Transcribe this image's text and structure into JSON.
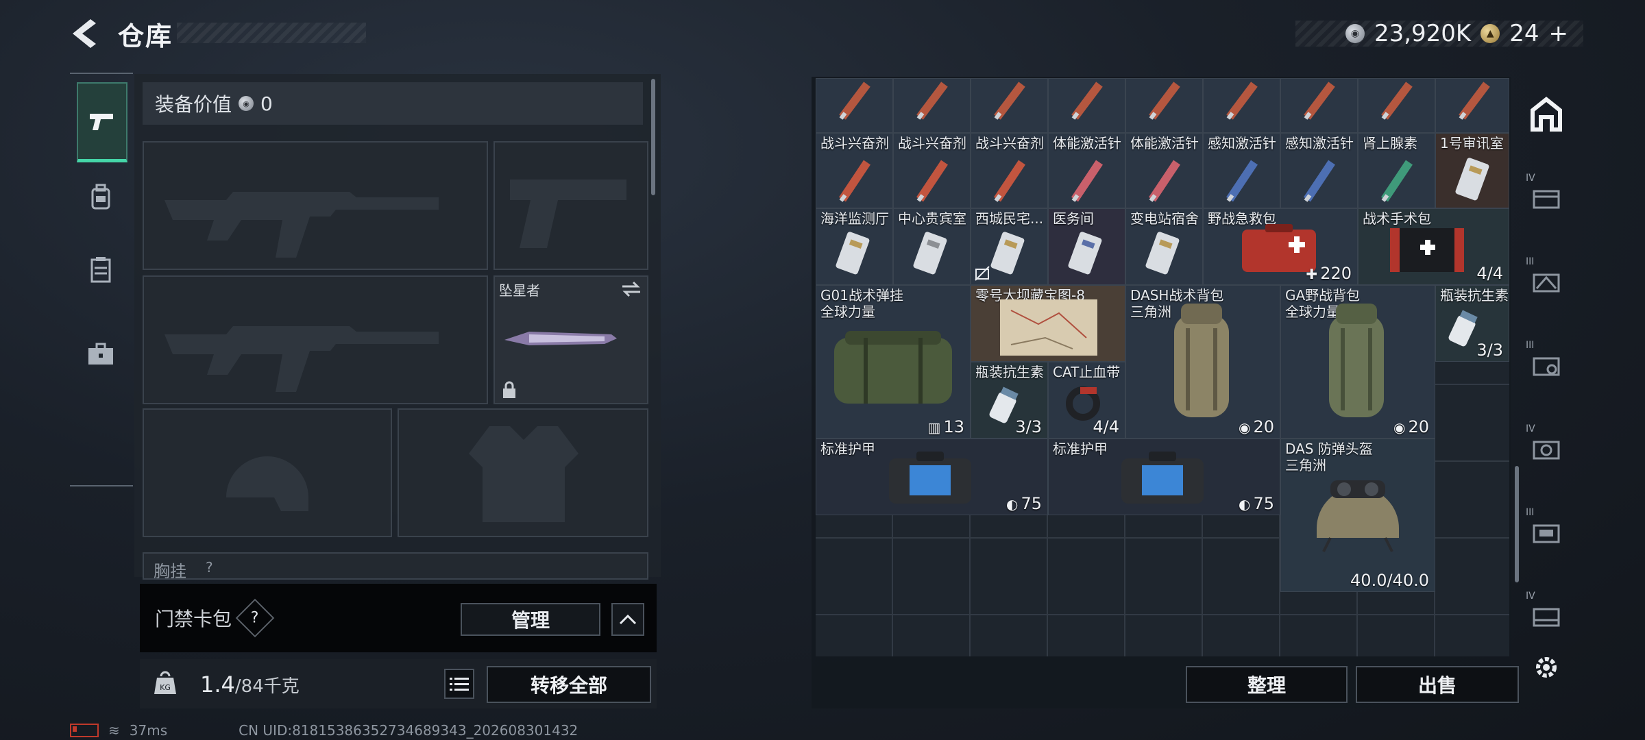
{
  "header": {
    "title": "仓库"
  },
  "currency": {
    "silver": "23,920K",
    "gold": "24",
    "gold_plus": "+"
  },
  "loadout": {
    "equip_value_label": "装备价值",
    "equip_value": "0",
    "melee_name": "坠星者",
    "chest_label": "胸挂",
    "chest_help": "?"
  },
  "cardcase": {
    "label": "门禁卡包",
    "help": "?",
    "manage": "管理"
  },
  "weight": {
    "current": "1.4",
    "max_unit": "/84千克",
    "icon_text": "KG"
  },
  "buttons": {
    "transfer_all": "转移全部",
    "sort": "整理",
    "sell": "出售"
  },
  "storage": {
    "items": [
      {
        "name": "战斗兴奋剂",
        "sub": "",
        "count": ""
      },
      {
        "name": "战斗兴奋剂",
        "sub": "",
        "count": ""
      },
      {
        "name": "战斗兴奋剂",
        "sub": "",
        "count": ""
      },
      {
        "name": "体能激活针",
        "sub": "",
        "count": ""
      },
      {
        "name": "体能激活针",
        "sub": "",
        "count": ""
      },
      {
        "name": "感知激活针",
        "sub": "",
        "count": ""
      },
      {
        "name": "感知激活针",
        "sub": "",
        "count": ""
      },
      {
        "name": "肾上腺素",
        "sub": "",
        "count": ""
      },
      {
        "name": "1号审讯室",
        "sub": "",
        "count": ""
      },
      {
        "name": "海洋监测厅",
        "sub": "",
        "count": ""
      },
      {
        "name": "中心贵宾室",
        "sub": "",
        "count": ""
      },
      {
        "name": "西城民宅...",
        "sub": "",
        "count": ""
      },
      {
        "name": "医务间",
        "sub": "",
        "count": ""
      },
      {
        "name": "变电站宿舍",
        "sub": "",
        "count": ""
      },
      {
        "name": "野战急救包",
        "sub": "",
        "count": "220"
      },
      {
        "name": "战术手术包",
        "sub": "",
        "count": "4/4"
      },
      {
        "name": "G01战术弹挂",
        "sub": "全球力量",
        "count": "13"
      },
      {
        "name": "零号大坝藏宝图-8",
        "sub": "",
        "count": ""
      },
      {
        "name": "DASH战术背包",
        "sub": "三角洲",
        "count": "20"
      },
      {
        "name": "GA野战背包",
        "sub": "全球力量",
        "count": "20"
      },
      {
        "name": "瓶装抗生素",
        "sub": "",
        "count": "3/3"
      },
      {
        "name": "瓶装抗生素",
        "sub": "",
        "count": "3/3"
      },
      {
        "name": "CAT止血带",
        "sub": "",
        "count": "4/4"
      },
      {
        "name": "标准护甲",
        "sub": "",
        "count": "75"
      },
      {
        "name": "标准护甲",
        "sub": "",
        "count": "75"
      },
      {
        "name": "DAS 防弹头盔",
        "sub": "三角洲",
        "count": "40.0/40.0"
      }
    ]
  },
  "right_rail": {
    "labels": [
      "IV",
      "III",
      "III",
      "IV",
      "III",
      "IV"
    ]
  },
  "status": {
    "ping": "37ms",
    "uid": "CN UID:8181538635273468934​3_202608301432"
  },
  "colors": {
    "accent": "#45d6a8",
    "panel": "#1e252d"
  }
}
